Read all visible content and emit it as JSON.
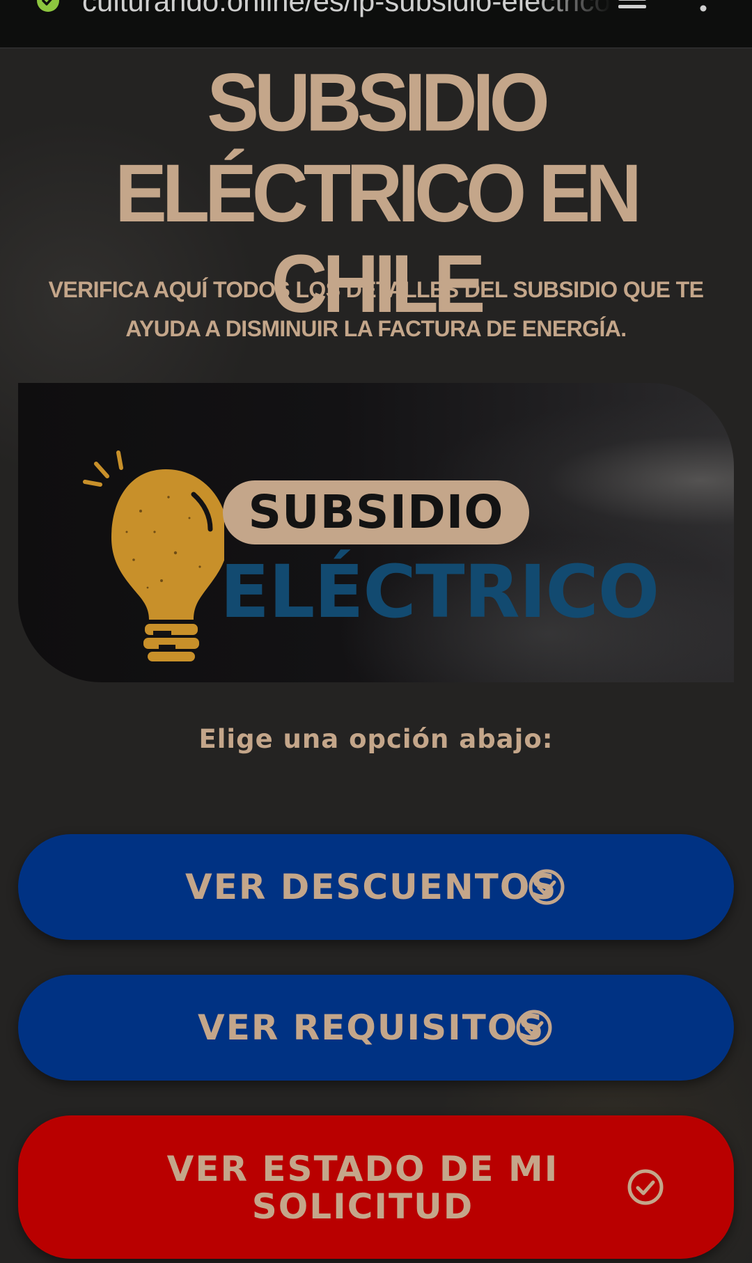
{
  "browser": {
    "url": "culturando.online/es/lp-subsidio-electrico"
  },
  "header": {
    "title": "SUBSIDIO ELÉCTRICO EN CHILE",
    "subtitle": "VERIFICA AQUÍ TODOS LOS DETALLES DEL SUBSIDIO QUE TE AYUDA A DISMINUIR LA FACTURA DE ENERGÍA."
  },
  "banner": {
    "logo_top": "SUBSIDIO",
    "logo_bottom": "ELÉCTRICO",
    "icon": "lightbulb-icon"
  },
  "prompt": "Elige una opción abajo:",
  "buttons": [
    {
      "label": "VER DESCUENTOS",
      "color": "#003283",
      "icon": "check-circle-icon"
    },
    {
      "label": "VER REQUISITOS",
      "color": "#003283",
      "icon": "check-circle-icon"
    },
    {
      "label": "VER ESTADO DE MI SOLICITUD",
      "color": "#b90000",
      "icon": "check-circle-icon"
    }
  ],
  "colors": {
    "accent_text": "#c4a68a",
    "background": "#242322",
    "logo_blue": "#124a70",
    "bulb": "#c8902a"
  }
}
